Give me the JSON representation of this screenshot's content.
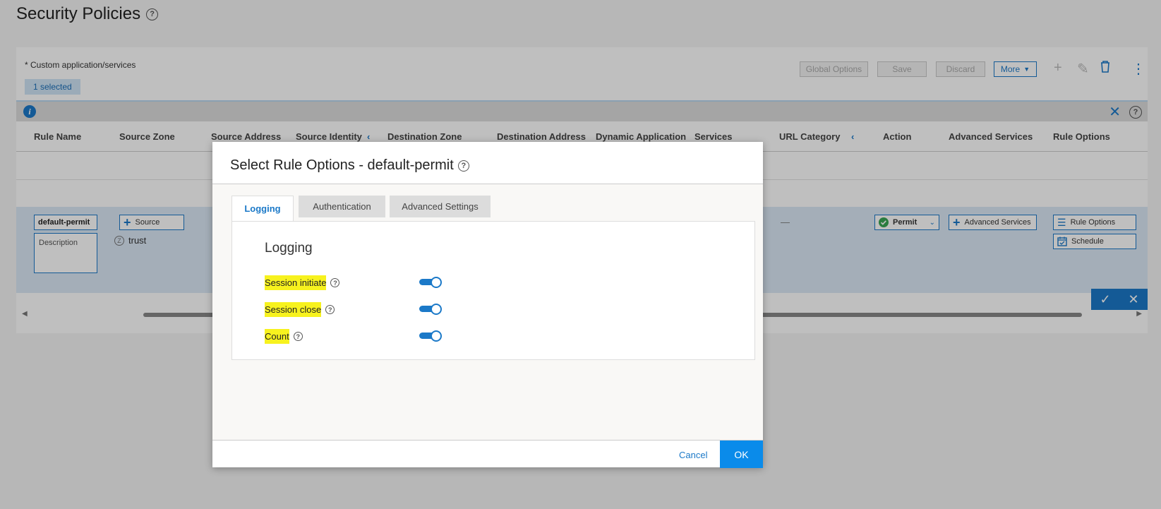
{
  "page": {
    "title": "Security Policies"
  },
  "toolbar": {
    "custom_note": "* Custom application/services",
    "selected": "1 selected",
    "global_options": "Global Options",
    "save": "Save",
    "discard": "Discard",
    "more": "More"
  },
  "table": {
    "columns": [
      "Rule Name",
      "Source Zone",
      "Source Address",
      "Source Identity",
      "Destination Zone",
      "Destination Address",
      "Dynamic Application",
      "Services",
      "URL Category",
      "Action",
      "Advanced Services",
      "Rule Options"
    ],
    "row": {
      "rule_name": "default-permit",
      "description_placeholder": "Description",
      "source_button": "Source",
      "source_zone": "trust",
      "url_category": "—",
      "action": "Permit",
      "advanced_services": "Advanced Services",
      "rule_options": "Rule Options",
      "schedule": "Schedule"
    }
  },
  "modal": {
    "title": "Select Rule Options - default-permit",
    "tabs": [
      "Logging",
      "Authentication",
      "Advanced Settings"
    ],
    "active_tab": "Logging",
    "section_title": "Logging",
    "options": [
      {
        "label": "Session initiate",
        "enabled": true
      },
      {
        "label": "Session close",
        "enabled": true
      },
      {
        "label": "Count",
        "enabled": true
      }
    ],
    "cancel": "Cancel",
    "ok": "OK"
  },
  "colors": {
    "accent": "#1b79c8",
    "ok_button": "#0a8bea",
    "highlight": "#f7f21e"
  },
  "icons": [
    "help-icon",
    "info-icon",
    "close-icon",
    "plus-icon",
    "edit-icon",
    "trash-icon",
    "kebab-icon",
    "check-icon",
    "chevron-left-icon",
    "chevron-down-icon",
    "list-icon",
    "calendar-icon"
  ]
}
